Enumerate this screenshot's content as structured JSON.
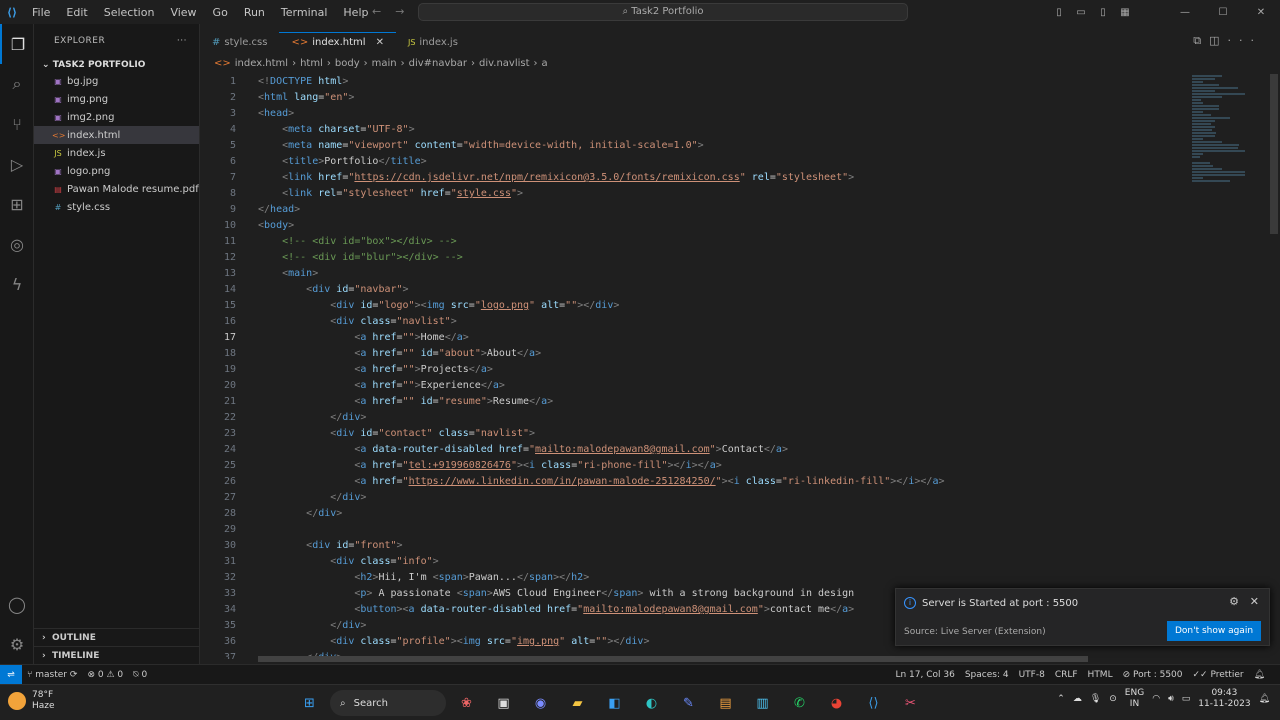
{
  "menu": [
    "File",
    "Edit",
    "Selection",
    "View",
    "Go",
    "Run",
    "Terminal",
    "Help"
  ],
  "command_center": "Task2 Portfolio",
  "explorer": {
    "title": "EXPLORER",
    "folder": "TASK2 PORTFOLIO",
    "files": [
      {
        "name": "bg.jpg",
        "icon": "image-file-icon",
        "color": "#a074c4"
      },
      {
        "name": "img.png",
        "icon": "image-file-icon",
        "color": "#a074c4"
      },
      {
        "name": "img2.png",
        "icon": "image-file-icon",
        "color": "#a074c4"
      },
      {
        "name": "index.html",
        "icon": "html-file-icon",
        "color": "#e37933"
      },
      {
        "name": "index.js",
        "icon": "js-file-icon",
        "color": "#cbcb41"
      },
      {
        "name": "logo.png",
        "icon": "image-file-icon",
        "color": "#a074c4"
      },
      {
        "name": "Pawan Malode resume.pdf",
        "icon": "pdf-file-icon",
        "color": "#cc3e44"
      },
      {
        "name": "style.css",
        "icon": "css-file-icon",
        "color": "#519aba"
      }
    ],
    "outline": "OUTLINE",
    "timeline": "TIMELINE"
  },
  "tabs": [
    {
      "label": "style.css",
      "icon": "#"
    },
    {
      "label": "index.html",
      "icon": "<>"
    },
    {
      "label": "index.js",
      "icon": "JS"
    }
  ],
  "breadcrumb": [
    "index.html",
    "html",
    "body",
    "main",
    "div#navbar",
    "div.navlist",
    "a"
  ],
  "notification": {
    "message": "Server is Started at port : 5500",
    "source": "Source: Live Server (Extension)",
    "button": "Don't show again"
  },
  "status": {
    "branch": "master",
    "problems": "0",
    "warnings": "0",
    "ports": "0",
    "cursor": "Ln 17, Col 36",
    "spaces": "Spaces: 4",
    "encoding": "UTF-8",
    "eol": "CRLF",
    "language": "HTML",
    "port": "Port : 5500",
    "prettier": "Prettier"
  },
  "taskbar": {
    "temp": "78°F",
    "weather": "Haze",
    "search": "Search",
    "lang1": "ENG",
    "lang2": "IN",
    "time": "09:43",
    "date": "11-11-2023"
  }
}
